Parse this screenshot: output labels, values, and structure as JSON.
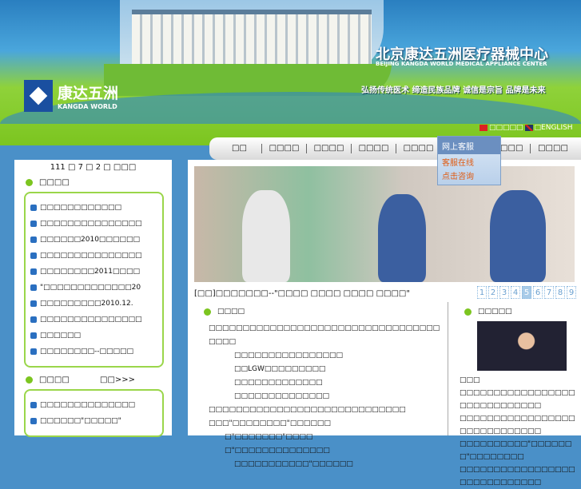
{
  "header": {
    "logo_cn": "康达五洲",
    "logo_en": "KANGDA WORLD",
    "title": "北京康达五洲医疗器械中心",
    "title_en": "BEIJING KANGDA WORLD MEDICAL APPLIANCE CENTER",
    "slogan": "弘扬传统医术  缔造民族品牌  诚信是宗旨  品牌是未来",
    "lang_cn": "□□□□□",
    "lang_en": "□ENGLISH"
  },
  "nav": [
    "□□",
    "□□□□",
    "□□□□",
    "□□□□",
    "□□□□",
    "□□□□",
    "□□□□",
    "□□□□"
  ],
  "kefu": {
    "title": "网上客服",
    "items": [
      "客服在线",
      "点击咨询"
    ]
  },
  "left": {
    "date": "111 □ 7 □ 2 □ □□□",
    "news_title": "□□□□",
    "news": [
      "□□□□□□□□□□□□",
      "□□□□□□□□□□□□□□□",
      "□□□□□□2010□□□□□□",
      "□□□□□□□□□□□□□□□",
      "□□□□□□□□2011□□□□",
      "\"□□□□□□□□□□□□□20",
      "□□□□□□□□□2010.12.",
      "□□□□□□□□□□□□□□□",
      "□□□□□□",
      "□□□□□□□□--□□□□□"
    ],
    "sec2_title": "□□□□",
    "more": "□□>>>",
    "sec2": [
      "□□□□□□□□□□□□□□",
      "□□□□□□\"□□□□□\""
    ]
  },
  "main": {
    "caption": "[□□]□□□□□□□--\"□□□□ □□□□ □□□□ □□□□\"",
    "pages": [
      "1",
      "2",
      "3",
      "4",
      "5",
      "6",
      "7",
      "8",
      "9"
    ],
    "active_page": "5",
    "intro_title": "□□□□",
    "intro": [
      "□□□□□□□□□□□□□□□□□□□□□□□□□□□□□□□□□□□□□□",
      "□□□□□□□□□□□□□□□□",
      "□□LGW□□□□□□□□□",
      "□□□□□□□□□□□□□",
      "□□□□□□□□□□□□□□",
      "□□□□□□□□□□□□□□□□□□□□□□□□□□□□□",
      "□□□\"□□□□□□□□\"□□□□□□",
      "□\"□□□□□□□\"□□□□",
      "□\"□□□□□□□□□□□□□□",
      "□□□□□□□□□□□\"□□□□□□"
    ],
    "leader_title": "□□□□□",
    "leader_name": "□□□",
    "leader_text": [
      "□□□□□□□□□□□□□□□□□□□□□□□□□□□□□",
      "□□□□□□□□□□□□□□□□□□□□□□□□□□□□□",
      "□□□□□□□□□□\"□□□□□□□\"□□□□□□□□",
      "□□□□□□□□□□□□□□□□□□□□□□□□□□□□□"
    ]
  }
}
